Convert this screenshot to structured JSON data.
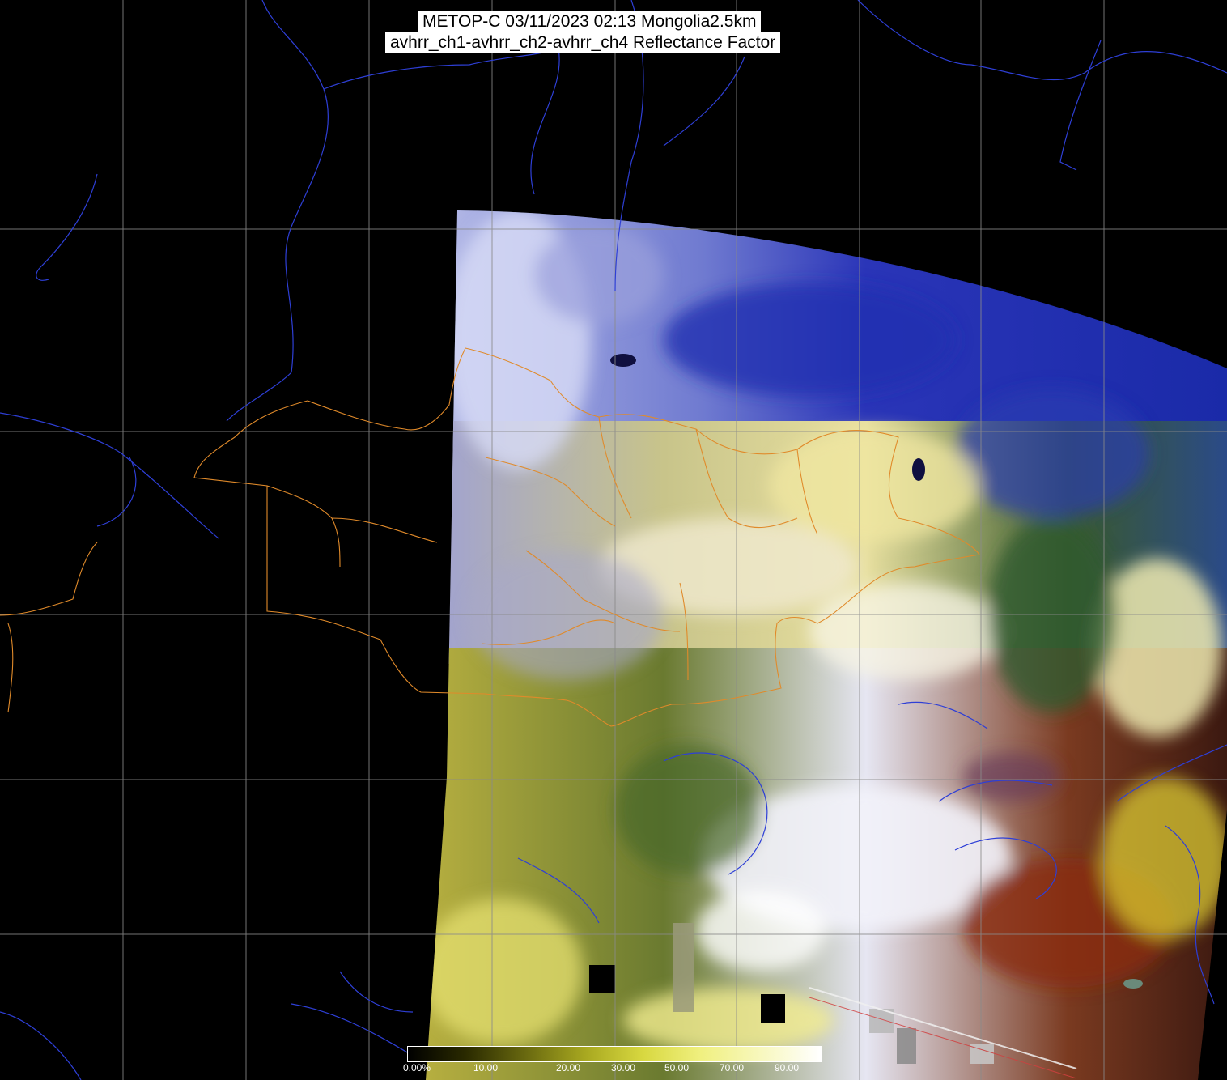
{
  "title": {
    "line1": "METOP-C 03/11/2023 02:13 Mongolia2.5km",
    "line2": "avhrr_ch1-avhrr_ch2-avhrr_ch4 Reflectance Factor"
  },
  "colorbar": {
    "tick_labels": [
      "0.00%",
      "10.00",
      "20.00",
      "30.00",
      "50.00",
      "70.00",
      "90.00"
    ],
    "gradient_colors": [
      "#000000",
      "#2a2a00",
      "#6b6b10",
      "#a8a820",
      "#d8d840",
      "#f0f080",
      "#f8f8c0",
      "#ffffff"
    ]
  },
  "map": {
    "grid_color": "#8a8a8a",
    "coastline_color": "#2e3fd6",
    "border_color": "#e08a2a",
    "background_color": "#000000"
  }
}
